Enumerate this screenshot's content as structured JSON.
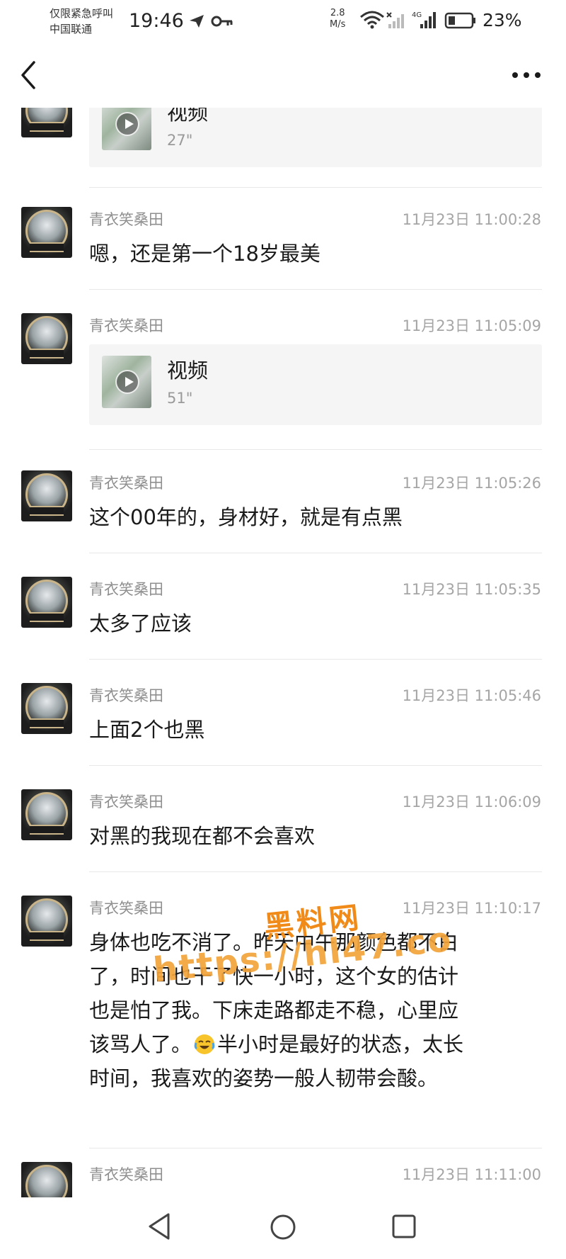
{
  "status_bar": {
    "carrier_line1": "仅限紧急呼叫",
    "carrier_line2": "中国联通",
    "time": "19:46",
    "net_speed_value": "2.8",
    "net_speed_unit": "M/s",
    "signal_label": "4G",
    "battery": "23%"
  },
  "messages": [
    {
      "type": "video",
      "label": "视频",
      "duration": "27\""
    },
    {
      "type": "text",
      "sender": "青衣笑桑田",
      "timestamp": "11月23日 11:00:28",
      "text": "嗯，还是第一个18岁最美"
    },
    {
      "type": "video",
      "sender": "青衣笑桑田",
      "timestamp": "11月23日 11:05:09",
      "label": "视频",
      "duration": "51\""
    },
    {
      "type": "text",
      "sender": "青衣笑桑田",
      "timestamp": "11月23日 11:05:26",
      "text": "这个00年的，身材好，就是有点黑"
    },
    {
      "type": "text",
      "sender": "青衣笑桑田",
      "timestamp": "11月23日 11:05:35",
      "text": "太多了应该"
    },
    {
      "type": "text",
      "sender": "青衣笑桑田",
      "timestamp": "11月23日 11:05:46",
      "text": "上面2个也黑"
    },
    {
      "type": "text",
      "sender": "青衣笑桑田",
      "timestamp": "11月23日 11:06:09",
      "text": "对黑的我现在都不会喜欢"
    },
    {
      "type": "text",
      "sender": "青衣笑桑田",
      "timestamp": "11月23日 11:10:17",
      "lines": [
        "身体也吃不消了。昨天中午那颜色都不白",
        "了，时间也干了快一小时，这个女的估计",
        "也是怕了我。下床走路都走不稳，心里应",
        "该骂人了。",
        "半小时是最好的状态，太长",
        "时间，我喜欢的姿势一般人韧带会酸。"
      ]
    },
    {
      "type": "text",
      "sender": "青衣笑桑田",
      "timestamp": "11月23日 11:11:00"
    }
  ],
  "watermark": {
    "line1": "黑料网",
    "line2": "https://hl47.co",
    "color": "#f08a18"
  },
  "icons": {
    "back": "chevron-left-icon",
    "more": "more-dots-icon",
    "emoji": "crying-laughing-emoji-icon",
    "nav_back": "triangle-back-icon",
    "nav_home": "circle-home-icon",
    "nav_recent": "square-recent-icon"
  }
}
